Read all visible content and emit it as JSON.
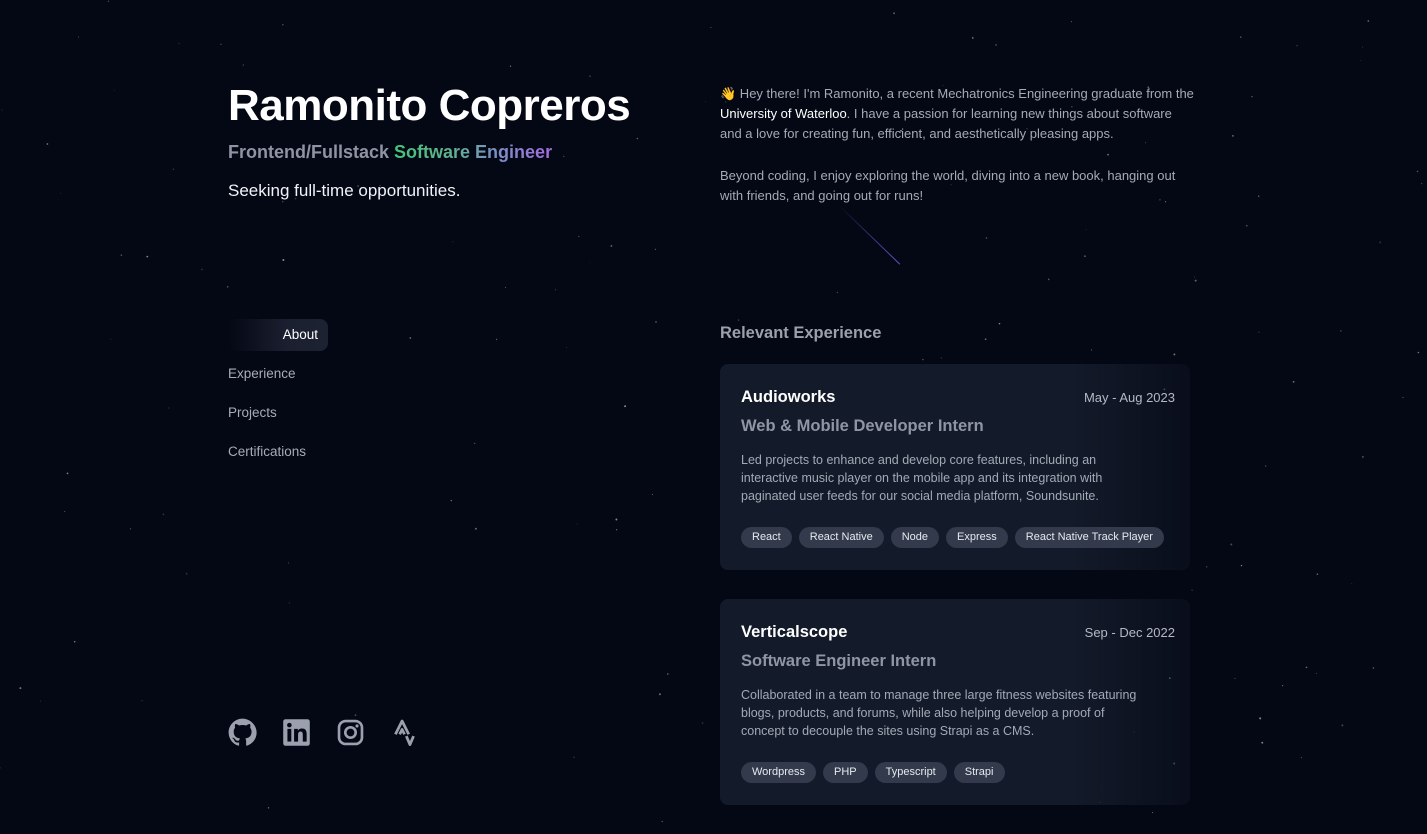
{
  "profile": {
    "name": "Ramonito Copreros",
    "role_prefix": "Frontend/Fullstack ",
    "role_highlight": "Software Engineer",
    "seeking": "Seeking full-time opportunities."
  },
  "nav": {
    "items": [
      {
        "label": "About",
        "active": true
      },
      {
        "label": "Experience",
        "active": false
      },
      {
        "label": "Projects",
        "active": false
      },
      {
        "label": "Certifications",
        "active": false
      }
    ]
  },
  "socials": [
    {
      "icon": "github-icon"
    },
    {
      "icon": "linkedin-icon"
    },
    {
      "icon": "instagram-icon"
    },
    {
      "icon": "strava-icon"
    }
  ],
  "about": {
    "wave_emoji": "👋",
    "p1_before": " Hey there! I'm Ramonito, a recent Mechatronics Engineering graduate from the ",
    "p1_link": "University of Waterloo",
    "p1_after": ". I have a passion for learning new things about software and a love for creating fun, efficient, and aesthetically pleasing apps.",
    "p2": "Beyond coding, I enjoy exploring the world, diving into a new book, hanging out with friends, and going out for runs!"
  },
  "experience": {
    "title": "Relevant Experience",
    "items": [
      {
        "company": "Audioworks",
        "dates": "May - Aug 2023",
        "position": "Web & Mobile Developer Intern",
        "description": "Led projects to enhance and develop core features, including an interactive music player on the mobile app and its integration with paginated user feeds for our social media platform, Soundsunite.",
        "tags": [
          "React",
          "React Native",
          "Node",
          "Express",
          "React Native Track Player"
        ]
      },
      {
        "company": "Verticalscope",
        "dates": "Sep - Dec 2022",
        "position": "Software Engineer Intern",
        "description": "Collaborated in a team to manage three large fitness websites featuring blogs, products, and forums, while also helping develop a proof of concept to decouple the sites using Strapi as a CMS.",
        "tags": [
          "Wordpress",
          "PHP",
          "Typescript",
          "Strapi"
        ]
      }
    ]
  },
  "colors": {
    "background": "#040714",
    "card": "#131a29",
    "tag": "#323a4b",
    "gradient_start": "#45c47a",
    "gradient_end": "#a36be0"
  }
}
